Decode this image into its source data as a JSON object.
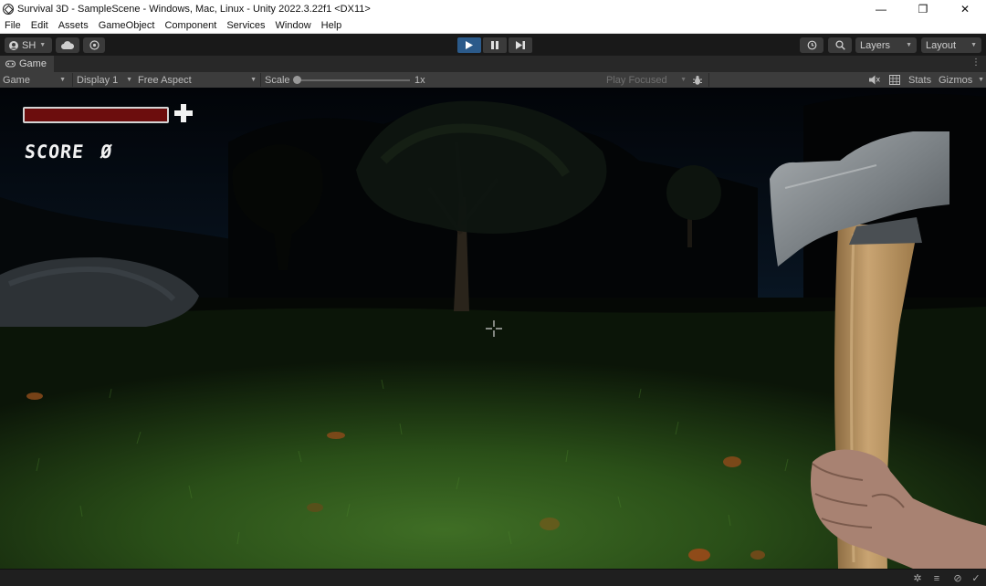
{
  "window": {
    "title": "Survival 3D - SampleScene - Windows, Mac, Linux - Unity 2022.3.22f1 <DX11>",
    "minimize_glyph": "—",
    "maximize_glyph": "❐",
    "close_glyph": "✕"
  },
  "menu": [
    "File",
    "Edit",
    "Assets",
    "GameObject",
    "Component",
    "Services",
    "Window",
    "Help"
  ],
  "toolbar": {
    "account_label": "SH",
    "layers_label": "Layers",
    "layout_label": "Layout",
    "play_active": true
  },
  "tab": {
    "label": "Game"
  },
  "gamebar": {
    "view_mode": "Game",
    "display": "Display 1",
    "aspect": "Free Aspect",
    "scale_label": "Scale",
    "scale_value": "1x",
    "play_mode": "Play Focused",
    "stats_label": "Stats",
    "gizmos_label": "Gizmos"
  },
  "hud": {
    "score_label": "SCORE",
    "score_value": "Ø",
    "health_color": "#6c0d0d"
  },
  "colors": {
    "unity_dark": "#191919",
    "panel": "#3c3c3c",
    "play_active": "#2b5a8a",
    "grass": "#2f5a1e",
    "axe_head": "#8a8f93",
    "axe_handle": "#b8935f"
  }
}
